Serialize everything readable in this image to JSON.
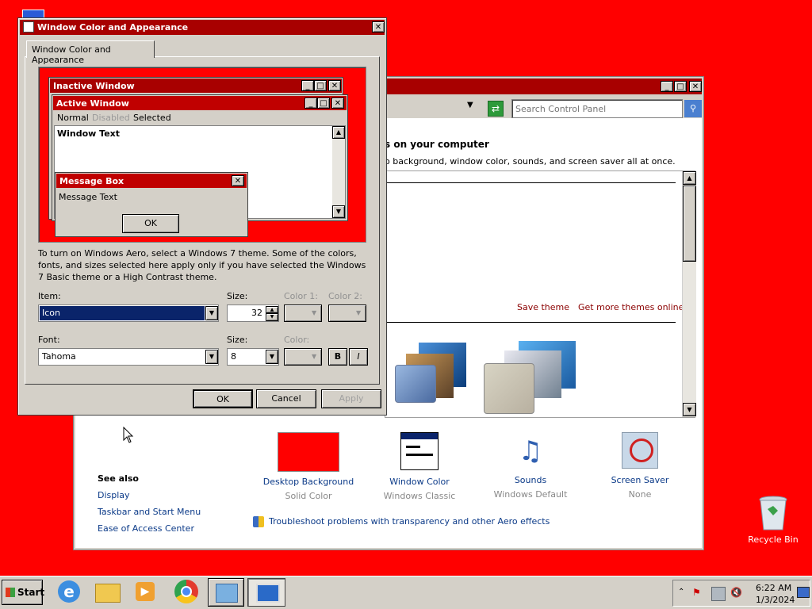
{
  "desktop": {
    "background": "#ff0000",
    "recycle_bin_label": "Recycle Bin"
  },
  "cp_window": {
    "search_placeholder": "Search Control Panel",
    "heading_partial": "s on your computer",
    "desc_partial": "o background, window color, sounds, and screen saver all at once.",
    "save_theme": "Save theme",
    "more_themes": "Get more themes online",
    "tiles": [
      {
        "title": "Desktop Background",
        "sub": "Solid Color"
      },
      {
        "title": "Window Color",
        "sub": "Windows Classic"
      },
      {
        "title": "Sounds",
        "sub": "Windows Default"
      },
      {
        "title": "Screen Saver",
        "sub": "None"
      }
    ],
    "troubleshoot": "Troubleshoot problems with transparency and other Aero effects",
    "see_also": {
      "heading": "See also",
      "links": [
        "Display",
        "Taskbar and Start Menu",
        "Ease of Access Center"
      ]
    }
  },
  "dialog": {
    "title": "Window Color and Appearance",
    "tab": "Window Color and Appearance",
    "preview": {
      "inactive": "Inactive Window",
      "active": "Active Window",
      "menu": [
        "Normal",
        "Disabled",
        "Selected"
      ],
      "window_text": "Window Text",
      "msgbox_title": "Message Box",
      "msgbox_text": "Message Text",
      "msgbox_ok": "OK"
    },
    "info": "To turn on Windows Aero, select a Windows 7 theme.  Some of the colors, fonts, and sizes selected here apply only if you have selected the Windows 7 Basic theme or a High Contrast theme.",
    "labels": {
      "item": "Item:",
      "size": "Size:",
      "color1": "Color 1:",
      "color2": "Color 2:",
      "font": "Font:",
      "size2": "Size:",
      "color": "Color:"
    },
    "item_value": "Icon",
    "size_value": "32",
    "font_value": "Tahoma",
    "font_size_value": "8",
    "bold": "B",
    "italic": "I",
    "buttons": {
      "ok": "OK",
      "cancel": "Cancel",
      "apply": "Apply"
    }
  },
  "taskbar": {
    "start": "Start",
    "time": "6:22 AM",
    "date": "1/3/2024"
  }
}
